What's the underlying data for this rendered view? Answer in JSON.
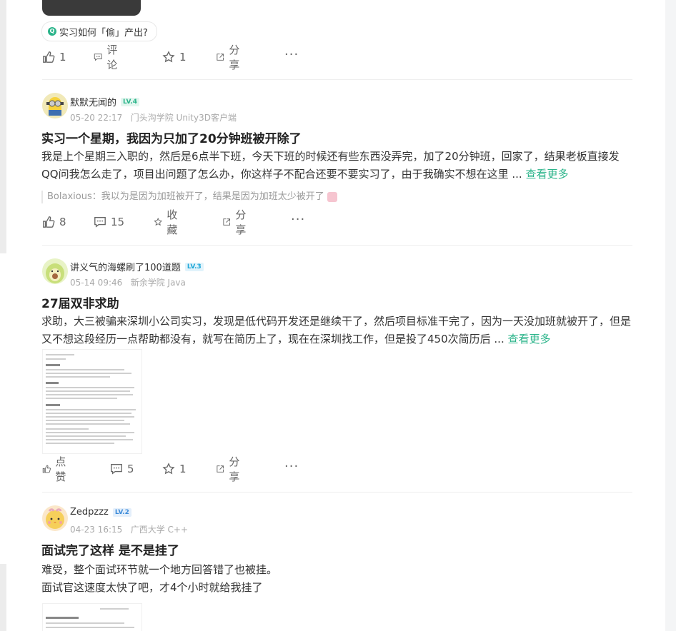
{
  "top": {
    "topic": "实习如何「偷」产出?",
    "actions": {
      "like": "1",
      "comment": "评论",
      "star": "1",
      "share": "分享",
      "more": "···"
    }
  },
  "posts": [
    {
      "user": "默默无闻的",
      "level": "LV.4",
      "date": "05-20 22:17",
      "org": "门头沟学院 Unity3D客户端",
      "title": "实习一个星期，我因为只加了20分钟班被开除了",
      "body": "我是上个星期三入职的，然后是6点半下班，今天下班的时候还有些东西没弄完，加了20分钟班，回家了，结果老板直接发QQ问我怎么走了，项目出问题了怎么办，你这样子不配合还要不要实习了，由于我确实不想在这里 ...",
      "see_more": "查看更多",
      "comment_user": "Bolaxious：",
      "comment_text": "我以为是因为加班被开了，结果是因为加班太少被开了",
      "actions": {
        "like": "8",
        "comment": "15",
        "star": "收藏",
        "share": "分享",
        "more": "···"
      }
    },
    {
      "user": "讲义气的海螺刷了100道题",
      "level": "LV.3",
      "date": "05-14 09:46",
      "org": "新余学院 Java",
      "title": "27届双非求助",
      "body": "求助，大三被骗来深圳小公司实习，发现是低代码开发还是继续干了，然后项目标准干完了，因为一天没加班就被开了，但是又不想这段经历一点帮助都没有，就写在简历上了，现在在深圳找工作，但是投了450次简历后 ...",
      "see_more": "查看更多",
      "actions": {
        "like": "点赞",
        "comment": "5",
        "star": "1",
        "share": "分享",
        "more": "···"
      }
    },
    {
      "user": "Zedpzzz",
      "level": "LV.2",
      "date": "04-23 16:15",
      "org": "广西大学 C++",
      "title": "面试完了这样 是不是挂了",
      "body_line1": "难受，整个面试环节就一个地方回答错了也被挂。",
      "body_line2": "面试官这速度太快了吧，才4个小时就给我挂了"
    }
  ],
  "colors": {
    "accent": "#2bb48a",
    "text": "#333333",
    "muted": "#999999"
  }
}
